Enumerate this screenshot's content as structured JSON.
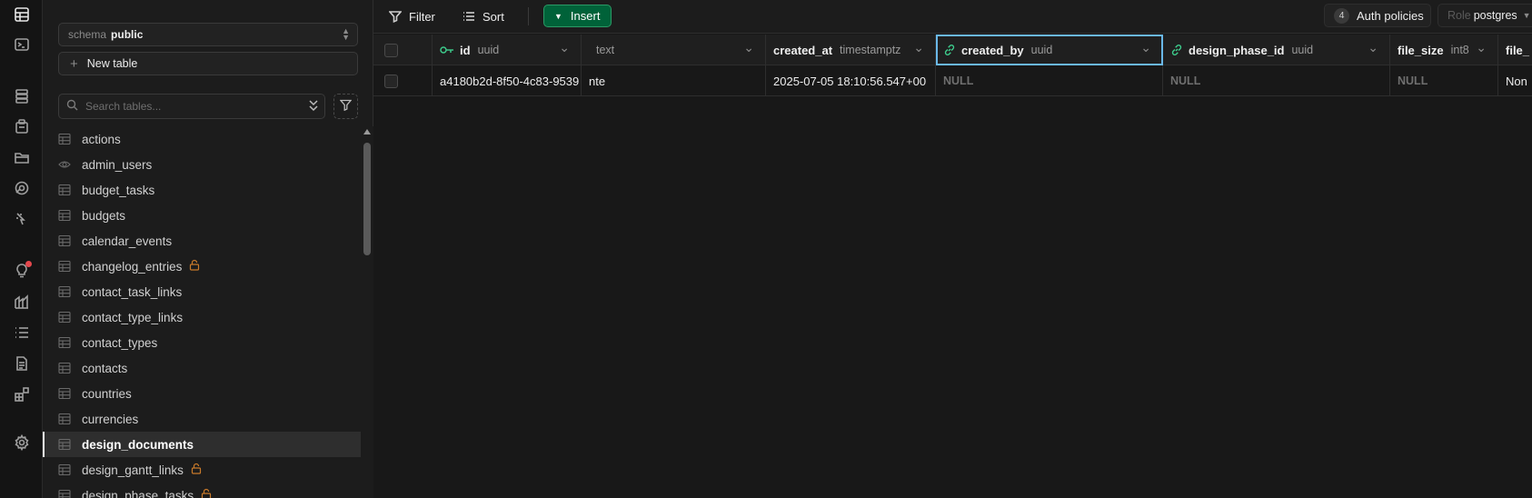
{
  "rail": {
    "icons": [
      "table-editor-icon",
      "sql-editor-icon",
      "database-icon",
      "auth-icon",
      "storage-icon",
      "edge-functions-icon",
      "realtime-icon",
      "advisors-icon",
      "reports-icon",
      "logs-icon",
      "api-docs-icon",
      "integrations-icon",
      "settings-icon"
    ]
  },
  "sidebar": {
    "schema_label": "schema",
    "schema_value": "public",
    "new_table_label": "New table",
    "search_placeholder": "Search tables...",
    "tables": [
      {
        "name": "actions",
        "icon": "table-icon",
        "locked": false
      },
      {
        "name": "admin_users",
        "icon": "view-icon",
        "locked": false
      },
      {
        "name": "budget_tasks",
        "icon": "table-icon",
        "locked": false
      },
      {
        "name": "budgets",
        "icon": "table-icon",
        "locked": false
      },
      {
        "name": "calendar_events",
        "icon": "table-icon",
        "locked": false
      },
      {
        "name": "changelog_entries",
        "icon": "table-icon",
        "locked": true
      },
      {
        "name": "contact_task_links",
        "icon": "table-icon",
        "locked": false
      },
      {
        "name": "contact_type_links",
        "icon": "table-icon",
        "locked": false
      },
      {
        "name": "contact_types",
        "icon": "table-icon",
        "locked": false
      },
      {
        "name": "contacts",
        "icon": "table-icon",
        "locked": false
      },
      {
        "name": "countries",
        "icon": "table-icon",
        "locked": false
      },
      {
        "name": "currencies",
        "icon": "table-icon",
        "locked": false
      },
      {
        "name": "design_documents",
        "icon": "table-icon",
        "locked": false,
        "selected": true
      },
      {
        "name": "design_gantt_links",
        "icon": "table-icon",
        "locked": true
      },
      {
        "name": "design_phase_tasks",
        "icon": "table-icon",
        "locked": true
      }
    ]
  },
  "toolbar": {
    "filter_label": "Filter",
    "sort_label": "Sort",
    "insert_label": "Insert",
    "auth_count": "4",
    "auth_label": "Auth policies",
    "role_label": "Role",
    "role_value": "postgres"
  },
  "grid": {
    "columns": [
      {
        "name": "id",
        "type": "uuid",
        "key": "primary"
      },
      {
        "name": "",
        "type": "text",
        "key": ""
      },
      {
        "name": "created_at",
        "type": "timestamptz",
        "key": ""
      },
      {
        "name": "created_by",
        "type": "uuid",
        "key": "foreign"
      },
      {
        "name": "design_phase_id",
        "type": "uuid",
        "key": "foreign"
      },
      {
        "name": "file_size",
        "type": "int8",
        "key": ""
      },
      {
        "name": "file_",
        "type": "",
        "key": ""
      }
    ],
    "rows": [
      [
        "a4180b2d-8f50-4c83-9539",
        "nte",
        "2025-07-05 18:10:56.547+00",
        "NULL",
        "NULL",
        "NULL",
        "Non"
      ]
    ]
  },
  "colors": {
    "accent_green": "#006239",
    "focus_blue": "#6ab8e8",
    "key_green": "#3ecf8e",
    "lock_orange": "#c87a2a",
    "notification_red": "#e5484d"
  }
}
